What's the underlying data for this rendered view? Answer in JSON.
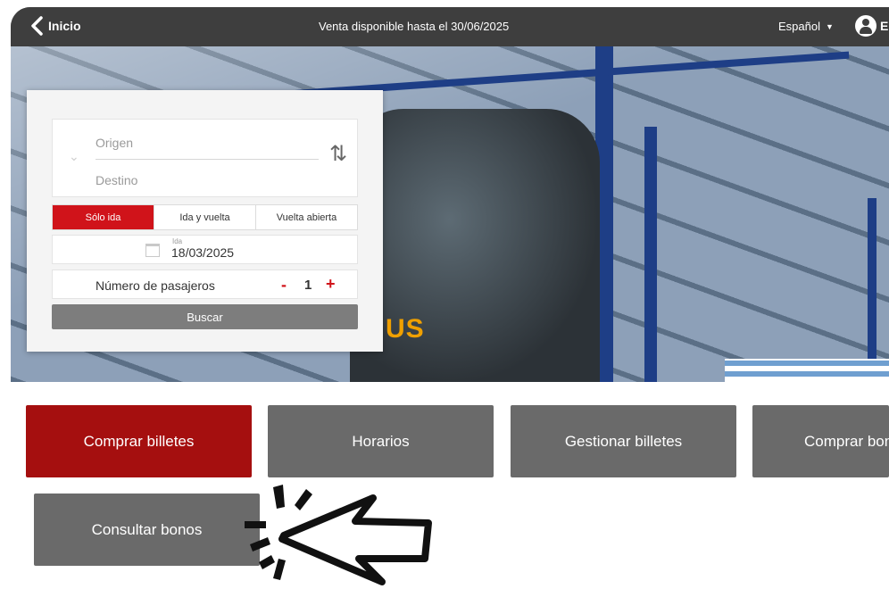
{
  "topbar": {
    "back_label": "Inicio",
    "notice": "Venta disponible hasta el 30/06/2025",
    "language": "Español",
    "user_initial": "E"
  },
  "hero": {
    "bus_sign": "US"
  },
  "search": {
    "origin_placeholder": "Origen",
    "destination_placeholder": "Destino",
    "trip_types": [
      "Sólo ida",
      "Ida y vuelta",
      "Vuelta abierta"
    ],
    "selected_trip_type": "Sólo ida",
    "date_label": "Ida",
    "date_value": "18/03/2025",
    "passengers_label": "Número de pasajeros",
    "passengers_value": "1",
    "minus_label": "-",
    "plus_label": "+",
    "submit_label": "Buscar"
  },
  "actions": {
    "buy_tickets": "Comprar billetes",
    "schedules": "Horarios",
    "manage_tickets": "Gestionar billetes",
    "buy_bonos": "Comprar bonos",
    "check_bonos": "Consultar bonos"
  },
  "colors": {
    "accent_red": "#d0131a",
    "primary_button": "#a50f0f",
    "secondary_button": "#6a6a6a",
    "topbar": "#3e3e3e"
  }
}
